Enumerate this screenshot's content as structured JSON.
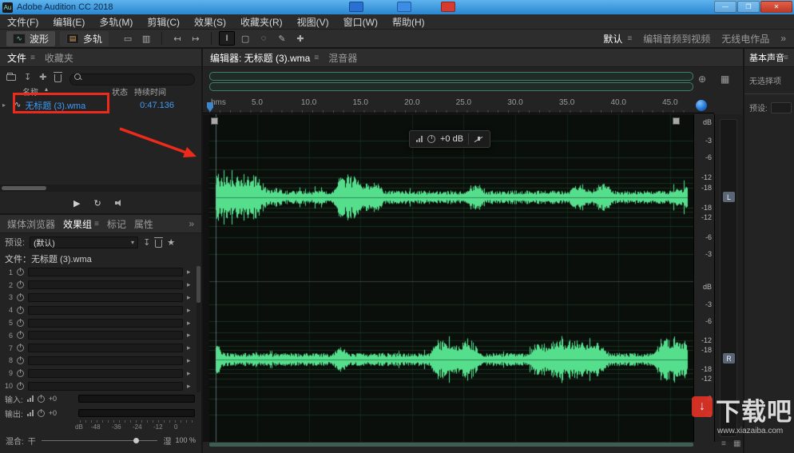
{
  "titlebar": {
    "title": "Adobe Audition CC 2018",
    "app_icon_text": "Au",
    "minimize": "—",
    "maximize": "❐",
    "close": "✕"
  },
  "menubar": {
    "items": [
      "文件(F)",
      "编辑(E)",
      "多轨(M)",
      "剪辑(C)",
      "效果(S)",
      "收藏夹(R)",
      "视图(V)",
      "窗口(W)",
      "帮助(H)"
    ]
  },
  "toolbar": {
    "waveform_btn": "波形",
    "multitrack_btn": "多轨",
    "waveform_icon_glyph": "∿",
    "multitrack_icon_glyph": "▤",
    "tools": [
      {
        "name": "video-panel-icon",
        "glyph": "▭"
      },
      {
        "name": "metering-panel-icon",
        "glyph": "▥"
      },
      {
        "name": "divider",
        "glyph": ""
      },
      {
        "name": "skip-back-icon",
        "glyph": "↤"
      },
      {
        "name": "skip-forward-icon",
        "glyph": "↦"
      },
      {
        "name": "divider",
        "glyph": ""
      },
      {
        "name": "time-selection-tool-icon",
        "glyph": "I",
        "active": true
      },
      {
        "name": "marquee-selection-tool-icon",
        "glyph": "▢"
      },
      {
        "name": "lasso-selection-tool-icon",
        "glyph": "◌"
      },
      {
        "name": "paintbrush-tool-icon",
        "glyph": "✎"
      },
      {
        "name": "spot-healing-brush-icon",
        "glyph": "✚"
      }
    ],
    "workspaces": [
      "默认",
      "编辑音频到视频",
      "无线电作品"
    ],
    "workspace_menu_icon": "≡",
    "overflow": "»"
  },
  "files_panel": {
    "tab_files": "文件",
    "tab_menu_icon": "≡",
    "tab_favorites": "收藏夹",
    "search_placeholder": "",
    "col_name": "名称",
    "sort_icon": "▴",
    "col_status": "状态",
    "col_duration": "持续时间",
    "file_name": "无标题 (3).wma",
    "file_icon_glyph": "∿",
    "file_duration": "0:47.136",
    "transport": {
      "play": "▶",
      "loop": "↻"
    }
  },
  "rack_panel": {
    "tabs": [
      "媒体浏览器",
      "效果组",
      "标记",
      "属性"
    ],
    "tab_menu_icon": "≡",
    "overflow": "»",
    "preset_label": "预设:",
    "preset_value": "(默认)",
    "preset_caret": "▾",
    "save_preset_icon": "↧",
    "favorite_icon": "★",
    "file_label": "文件：无标题 (3).wma",
    "slots": [
      "1",
      "2",
      "3",
      "4",
      "5",
      "6",
      "7",
      "8",
      "9",
      "10"
    ],
    "slot_arrow": "▸",
    "input_label": "输入:",
    "output_label": "输出:",
    "gain": "+0",
    "db_ruler": [
      "dB",
      "-48",
      "-36",
      "-24",
      "-12",
      "0"
    ],
    "mix_label": "混合:",
    "dry": "干",
    "wet": "湿",
    "mix_value": "100 %"
  },
  "editor": {
    "tab_editor": "编辑器: 无标题 (3).wma",
    "tab_menu_icon": "≡",
    "tab_mixer": "混音器",
    "hud_value": "+0 dB",
    "ruler": [
      "hms",
      "5.0",
      "10.0",
      "15.0",
      "20.0",
      "25.0",
      "30.0",
      "35.0",
      "40.0",
      "45.0"
    ],
    "db_unit": "dB",
    "scale": [
      "-3",
      "-6",
      "-12",
      "-18"
    ],
    "left_badge": "L",
    "right_badge": "R",
    "bottom_icons": [
      "≡",
      "▦"
    ]
  },
  "essential": {
    "title": "基本声音",
    "menu_icon": "≡",
    "no_selection": "无选择项",
    "preset_label": "预设:"
  },
  "watermark": {
    "logo_glyph": "↓",
    "brand": "下载吧",
    "site": "www.xiazaiba.com"
  },
  "colors": {
    "titlebar_blue": "#2f8fd8",
    "accent_blue": "#3f9bf5",
    "waveform_green": "#55df8c",
    "grid_green": "#16301e",
    "annotation_red": "#ed2a1c",
    "lr_badge": "#5a6675"
  }
}
